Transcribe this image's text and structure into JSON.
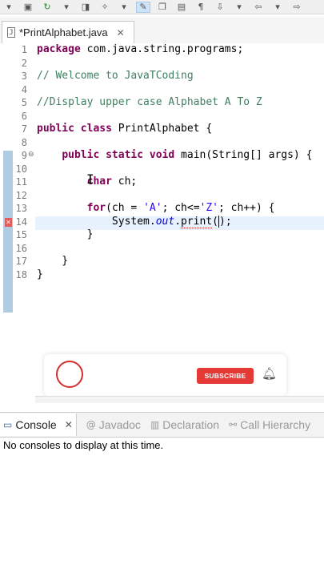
{
  "toolbar": {
    "icons": [
      "dropdown-icon",
      "package-icon",
      "refresh-icon",
      "dropdown-icon",
      "bucket-icon",
      "dropdown-icon",
      "wand-icon",
      "dropdown-icon",
      "highlight-icon",
      "copy-icon",
      "save-icon",
      "pilcrow-icon",
      "nav-down-icon",
      "dropdown-icon",
      "nav-left-icon",
      "dropdown-icon",
      "nav-right-icon"
    ]
  },
  "editor_tab": {
    "label": "*PrintAlphabet.java",
    "close": "✕",
    "icon": "J"
  },
  "code_lines": [
    {
      "n": "1",
      "text": "package com.java.string.programs;"
    },
    {
      "n": "2",
      "text": ""
    },
    {
      "n": "3",
      "text": "// Welcome to JavaTCoding"
    },
    {
      "n": "4",
      "text": ""
    },
    {
      "n": "5",
      "text": "//Display upper case Alphabet A To Z"
    },
    {
      "n": "6",
      "text": ""
    },
    {
      "n": "7",
      "text": "public class PrintAlphabet {"
    },
    {
      "n": "8",
      "text": ""
    },
    {
      "n": "9",
      "text": "    public static void main(String[] args) {"
    },
    {
      "n": "10",
      "text": ""
    },
    {
      "n": "11",
      "text": "        char ch;"
    },
    {
      "n": "12",
      "text": ""
    },
    {
      "n": "13",
      "text": "        for(ch = 'A'; ch<='Z'; ch++) {"
    },
    {
      "n": "14",
      "text": "            System.out.print();"
    },
    {
      "n": "15",
      "text": "        }"
    },
    {
      "n": "16",
      "text": ""
    },
    {
      "n": "17",
      "text": "    }"
    },
    {
      "n": "18",
      "text": "}"
    }
  ],
  "overlay": {
    "subscribe_label": "SUBSCRIBE"
  },
  "panel": {
    "tabs": [
      {
        "label": "Console",
        "icon": "console-icon",
        "active": true
      },
      {
        "label": "Javadoc",
        "icon": "at-icon",
        "active": false
      },
      {
        "label": "Declaration",
        "icon": "declaration-icon",
        "active": false
      },
      {
        "label": "Call Hierarchy",
        "icon": "hierarchy-icon",
        "active": false
      }
    ],
    "close": "✕",
    "console_message": "No consoles to display at this time."
  }
}
